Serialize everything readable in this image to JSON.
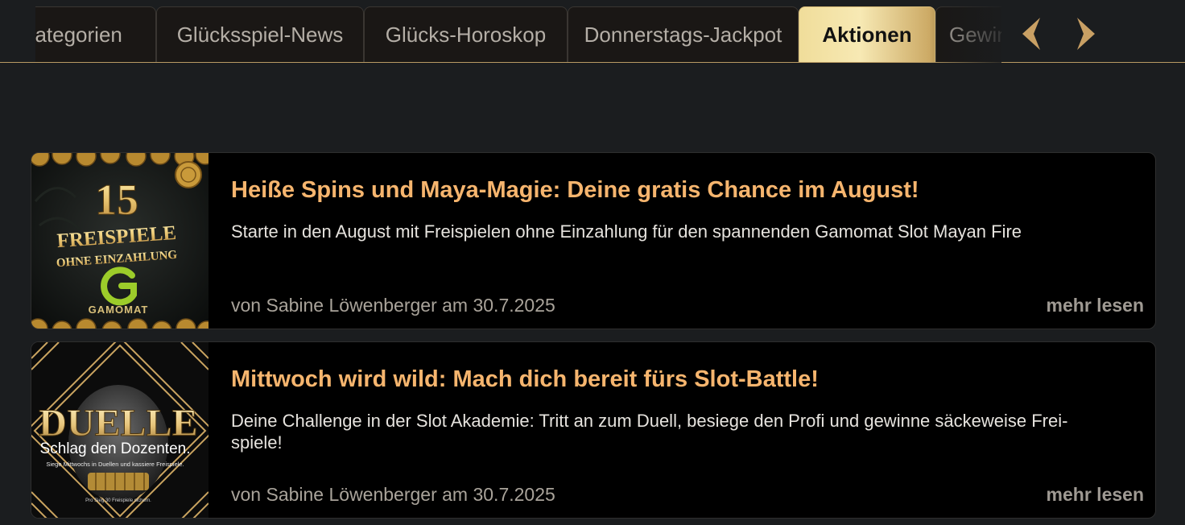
{
  "tabs": [
    {
      "label": "Kategorien",
      "active": false
    },
    {
      "label": "Glücksspiel-News",
      "active": false
    },
    {
      "label": "Glücks-Horoskop",
      "active": false
    },
    {
      "label": "Donnerstags-Jackpot",
      "active": false
    },
    {
      "label": "Aktionen",
      "active": true
    },
    {
      "label": "Gewinner",
      "active": false
    }
  ],
  "colors": {
    "accent_gold": "#f6b56e",
    "active_tab": "#f0dd9a",
    "background": "#1b1d1f",
    "card": "#000000"
  },
  "articles": [
    {
      "title": "Heiße Spins und Maya-Magie: Deine gratis Chance im August!",
      "teaser": "Starte in den August mit Freispielen ohne Einzahlung für den spannenden Gamomat Slot Mayan Fire",
      "meta": "von Sabine Löwenberger am 30.7.2025",
      "more": "mehr lesen",
      "image": {
        "number": "15",
        "line1": "FREISPIELE",
        "line2": "OHNE EINZAHLUNG",
        "brand": "GAMOMAT"
      }
    },
    {
      "title": "Mittwoch wird wild: Mach dich bereit fürs Slot-Battle!",
      "teaser": "Deine Challenge in der Slot Akademie: Tritt an zum Duell, besiege den Profi und gewinne säckeweise Frei-spiele!",
      "meta": "von Sabine Löwenberger am 30.7.2025",
      "more": "mehr lesen",
      "image": {
        "headline": "DUELLE",
        "subline": "Schlag den Dozenten.",
        "small": "Siege Mittwochs in Duellen und kassiere Freispiele.",
        "footer": "Pro Sieg 30 Freispiele sichern."
      }
    }
  ]
}
